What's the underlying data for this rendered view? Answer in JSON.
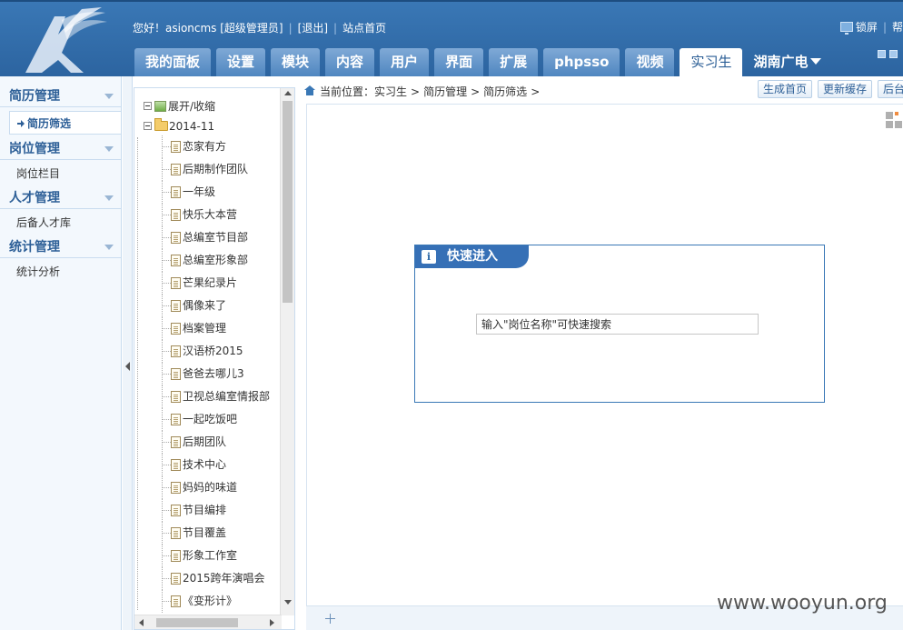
{
  "header": {
    "welcome": "您好！asioncms [超级管理员]",
    "logout": "[退出]",
    "site_home": "站点首页",
    "lock_screen": "锁屏",
    "help": "帮",
    "nav_tabs": [
      {
        "label": "我的面板"
      },
      {
        "label": "设置"
      },
      {
        "label": "模块"
      },
      {
        "label": "内容"
      },
      {
        "label": "用户"
      },
      {
        "label": "界面"
      },
      {
        "label": "扩展"
      },
      {
        "label": "phpsso"
      },
      {
        "label": "视频"
      },
      {
        "label": "实习生"
      },
      {
        "label": "湖南广电"
      }
    ],
    "active_tab": "实习生"
  },
  "sidebar": {
    "sections": [
      {
        "title": "简历管理",
        "items": [
          {
            "label": "简历筛选",
            "active": true
          }
        ]
      },
      {
        "title": "岗位管理",
        "items": [
          {
            "label": "岗位栏目"
          }
        ]
      },
      {
        "title": "人才管理",
        "items": [
          {
            "label": "后备人才库"
          }
        ]
      },
      {
        "title": "统计管理",
        "items": [
          {
            "label": "统计分析"
          }
        ]
      }
    ]
  },
  "tree": {
    "expand_collapse": "展开/收缩",
    "folder": "2014-11",
    "items": [
      "恋家有方",
      "后期制作团队",
      "一年级",
      "快乐大本营",
      "总编室节目部",
      "总编室形象部",
      "芒果纪录片",
      "偶像来了",
      "档案管理",
      "汉语桥2015",
      "爸爸去哪儿3",
      "卫视总编室情报部",
      "一起吃饭吧",
      "后期团队",
      "技术中心",
      "妈妈的味道",
      "节目编排",
      "节目覆盖",
      "形象工作室",
      "2015跨年演唱会",
      "《变形计》"
    ]
  },
  "breadcrumb": {
    "prefix": "当前位置：",
    "parts": [
      "实习生",
      ">",
      "简历管理",
      ">",
      "简历筛选",
      ">"
    ]
  },
  "toolbar": {
    "generate_home": "生成首页",
    "update_cache": "更新缓存",
    "backend": "后台"
  },
  "dialog": {
    "title": "快速进入",
    "input_value": "输入\"岗位名称\"可快速搜索"
  },
  "watermark": "www.wooyun.org",
  "colors": {
    "header_blue": "#2f6aa8",
    "dialog_blue": "#3670b6",
    "sidebar_bg": "#f3f8fd"
  }
}
